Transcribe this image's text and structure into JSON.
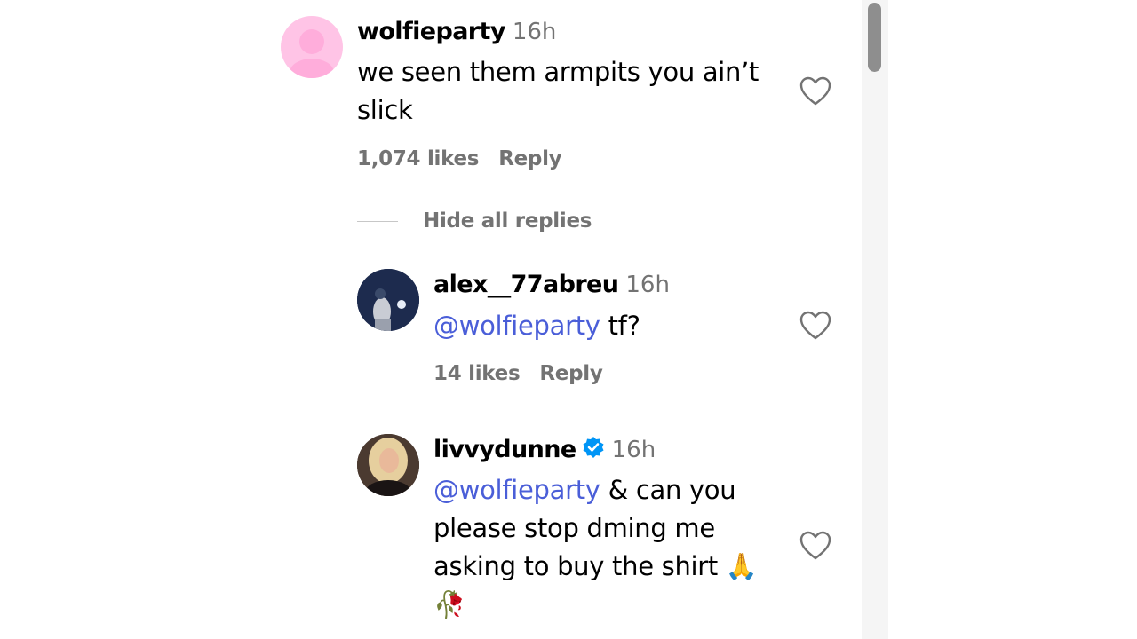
{
  "comments": [
    {
      "username": "wolfieparty",
      "time": "16h",
      "text_line1": "we seen them armpits you ain’t",
      "text_line2": "slick",
      "likes": "1,074 likes",
      "reply": "Reply",
      "avatar_icon": "default-avatar-icon",
      "avatar_color": "#ffc4e6"
    }
  ],
  "replies_toggle": {
    "label": "Hide all replies"
  },
  "replies": [
    {
      "username": "alex__77abreu",
      "time": "16h",
      "mention": "@wolfieparty",
      "text": " tf?",
      "likes": "14 likes",
      "reply": "Reply"
    },
    {
      "username": "livvydunne",
      "verified": true,
      "time": "16h",
      "mention": "@wolfieparty",
      "text_line1": " & can you",
      "text_line2": "please stop dming me",
      "text_line3": "asking to buy the shirt 🙏",
      "text_line4": "🥀"
    }
  ],
  "colors": {
    "mention": "#4a5ed8",
    "muted": "#737373",
    "verified": "#0095f6"
  }
}
